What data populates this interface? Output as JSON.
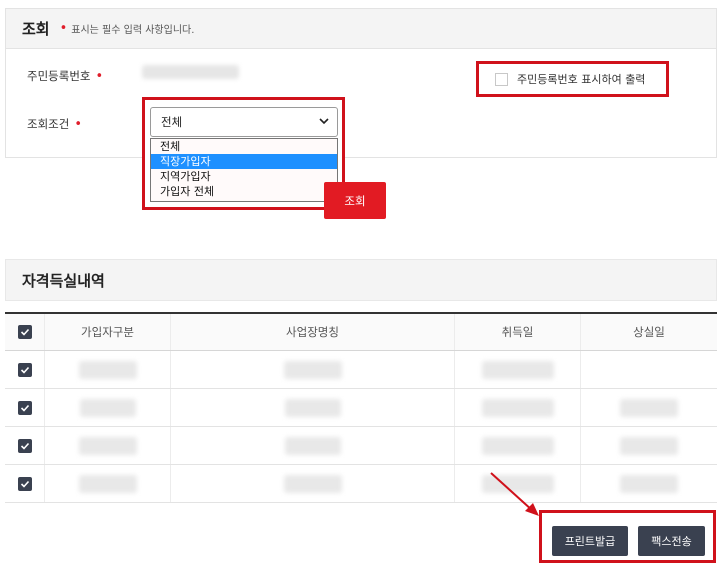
{
  "query": {
    "title": "조회",
    "required_note": "표시는 필수 입력 사항입니다.",
    "required_mark": "•",
    "resident_number_label": "주민등록번호",
    "condition_label": "조회조건",
    "condition_selected": "전체",
    "condition_options": [
      "전체",
      "직장가입자",
      "지역가입자",
      "가입자 전체"
    ],
    "highlighted_option": "직장가입자",
    "show_resident_number_label": "주민등록번호 표시하여 출력",
    "search_button": "조회"
  },
  "history": {
    "title": "자격득실내역",
    "columns": [
      "가입자구분",
      "사업장명칭",
      "취득일",
      "상실일"
    ],
    "rows": [
      {
        "checked": true
      },
      {
        "checked": true
      },
      {
        "checked": true
      },
      {
        "checked": true
      }
    ]
  },
  "actions": {
    "print_button": "프린트발급",
    "fax_button": "팩스전송"
  },
  "colors": {
    "accent_red": "#e21b23",
    "highlight_border": "#d0111b",
    "dark_button": "#3a4150",
    "selected_option": "#1e90ff"
  }
}
